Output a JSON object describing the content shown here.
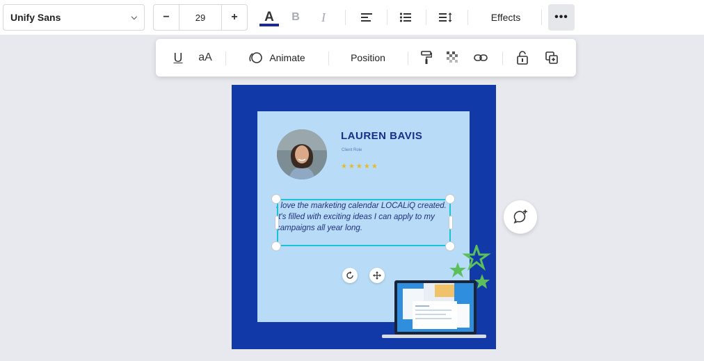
{
  "toolbar": {
    "font_family": "Unify Sans",
    "font_size": "29",
    "minus_label": "−",
    "plus_label": "+",
    "text_color_label": "A",
    "bold_label": "B",
    "italic_label": "I",
    "effects_label": "Effects",
    "more_label": "•••"
  },
  "float_toolbar": {
    "underline_label": "U",
    "case_label": "aA",
    "animate_label": "Animate",
    "position_label": "Position"
  },
  "card": {
    "name": "LAUREN BAVIS",
    "role": "Client Role",
    "stars": "★★★★★",
    "quote": "I love the marketing calendar LOCALiQ created. It's filled with exciting ideas I can apply to my campaigns all year long."
  },
  "colors": {
    "design_bg": "#1239a8",
    "card_bg": "#b8dcf7",
    "selection": "#19c2d6",
    "text_color_bar": "#1c2a8c",
    "stars": "#e8b925"
  }
}
